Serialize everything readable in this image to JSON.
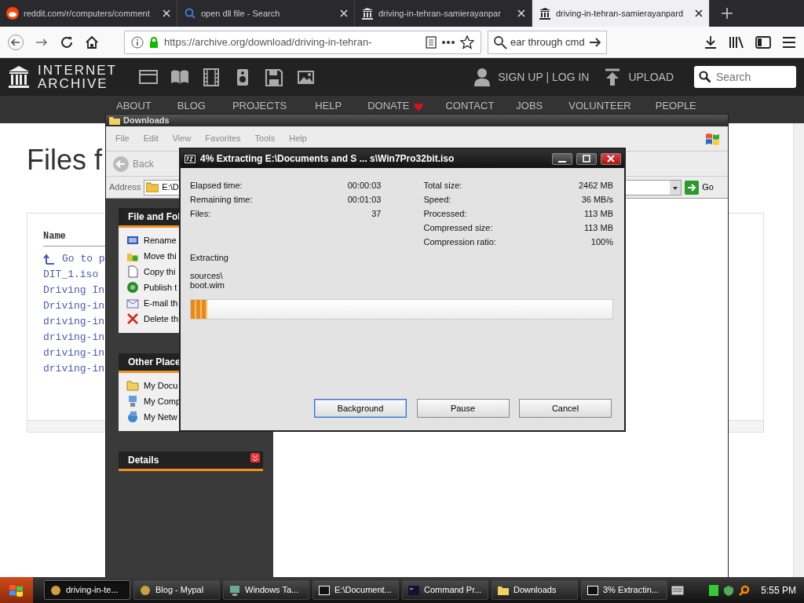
{
  "browser": {
    "tabs": [
      {
        "title": "reddit.com/r/computers/comment",
        "selected": false
      },
      {
        "title": "open dll file - Search",
        "selected": false
      },
      {
        "title": "driving-in-tehran-samierayanpar",
        "selected": false
      },
      {
        "title": "driving-in-tehran-samierayanpard",
        "selected": true
      }
    ],
    "url": "https://archive.org/download/driving-in-tehran-",
    "search": "ear through cmd"
  },
  "site": {
    "logo": [
      "INTERNET",
      "ARCHIVE"
    ],
    "account": "SIGN UP | LOG IN",
    "upload": "UPLOAD",
    "search_placeholder": "Search",
    "menu": [
      "ABOUT",
      "BLOG",
      "PROJECTS",
      "HELP",
      "DONATE",
      "CONTACT",
      "JOBS",
      "VOLUNTEER",
      "PEOPLE"
    ],
    "heading": "Files f",
    "list_header": "Name",
    "files": [
      "Go to p",
      "DIT_1.iso",
      "Driving In",
      "Driving-in",
      "driving-in",
      "driving-in",
      "driving-in",
      "driving-in"
    ]
  },
  "explorer": {
    "title": "Downloads",
    "menu": [
      "File",
      "Edit",
      "View",
      "Favorites",
      "Tools",
      "Help"
    ],
    "back": "Back",
    "address_label": "Address",
    "address": "E:\\D",
    "go": "Go",
    "panels": [
      {
        "title": "File and Fol",
        "items": [
          "Rename",
          "Move thi",
          "Copy thi",
          "Publish t",
          "E-mail th",
          "Delete th"
        ]
      },
      {
        "title": "Other Place",
        "items": [
          "My Docu",
          "My Comp",
          "My Netw"
        ]
      },
      {
        "title": "Details"
      }
    ]
  },
  "dialog": {
    "title": "4% Extracting E:\\Documents and S ... s\\Win7Pro32bit.iso",
    "left_stats": [
      {
        "label": "Elapsed time:",
        "value": "00:00:03"
      },
      {
        "label": "Remaining time:",
        "value": "00:01:03"
      },
      {
        "label": "Files:",
        "value": "37"
      }
    ],
    "right_stats": [
      {
        "label": "Total size:",
        "value": "2462 MB"
      },
      {
        "label": "Speed:",
        "value": "36 MB/s"
      },
      {
        "label": "Processed:",
        "value": "113 MB"
      },
      {
        "label": "Compressed size:",
        "value": "113 MB"
      },
      {
        "label": "Compression ratio:",
        "value": "100%"
      }
    ],
    "status": "Extracting",
    "path": "sources\\",
    "file": "boot.wim",
    "level": 0.04,
    "buttons": [
      {
        "label": "Background",
        "selected": true
      },
      {
        "label": "Pause",
        "selected": false
      },
      {
        "label": "Cancel",
        "selected": false
      }
    ]
  },
  "taskbar": {
    "items": [
      {
        "label": "driving-in-te...",
        "selected": true
      },
      {
        "label": "Blog - Mypal",
        "selected": false
      },
      {
        "label": "Windows Ta...",
        "selected": false
      },
      {
        "label": "E:\\Document...",
        "selected": false
      },
      {
        "label": "Command Pr...",
        "selected": false
      },
      {
        "label": "Downloads",
        "selected": false
      },
      {
        "label": "3% Extractin...",
        "selected": false
      }
    ],
    "clock": "5:55 PM"
  }
}
